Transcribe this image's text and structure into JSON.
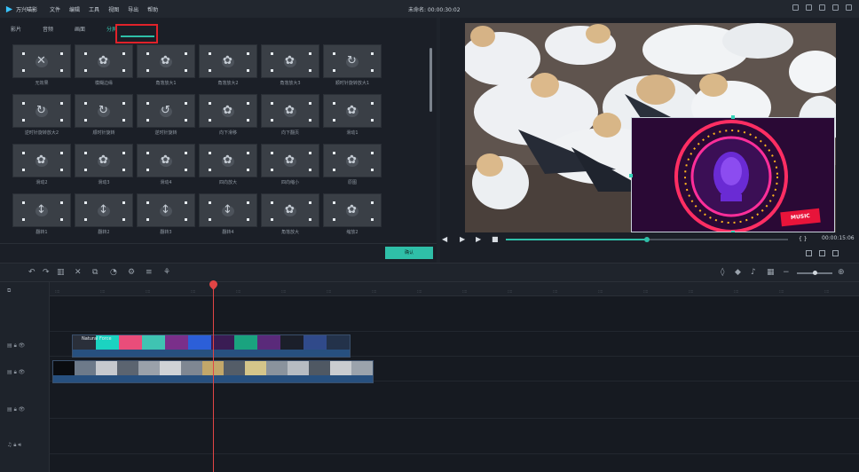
{
  "app": {
    "logo_text": "万兴喵影",
    "menu": [
      "文件",
      "编辑",
      "工具",
      "视图",
      "导出",
      "帮助"
    ],
    "project_title": "未命名: 00:00:30:02"
  },
  "library": {
    "tabs": [
      {
        "label": "影片"
      },
      {
        "label": "音频"
      },
      {
        "label": "画面"
      },
      {
        "label": "分屏"
      }
    ],
    "active_tab_index": 3,
    "ok_label": "确认",
    "items": [
      {
        "label": "无效果",
        "glyph": "✕"
      },
      {
        "label": "模糊边缘",
        "glyph": "✿"
      },
      {
        "label": "角落放大1",
        "glyph": "✿"
      },
      {
        "label": "角落放大2",
        "glyph": "✿"
      },
      {
        "label": "角落放大3",
        "glyph": "✿"
      },
      {
        "label": "顺时针旋转放大1",
        "glyph": "↻"
      },
      {
        "label": "逆时针旋转放大2",
        "glyph": "↻"
      },
      {
        "label": "顺时针旋转",
        "glyph": "↻"
      },
      {
        "label": "逆时针旋转",
        "glyph": "↺"
      },
      {
        "label": "向下滑移",
        "glyph": "✿"
      },
      {
        "label": "向下翻页",
        "glyph": "✿"
      },
      {
        "label": "滑动1",
        "glyph": "✿"
      },
      {
        "label": "滑动2",
        "glyph": "✿"
      },
      {
        "label": "滑动3",
        "glyph": "✿"
      },
      {
        "label": "滑动4",
        "glyph": "✿"
      },
      {
        "label": "四向放大",
        "glyph": "✿"
      },
      {
        "label": "四向缩小",
        "glyph": "✿"
      },
      {
        "label": "原图",
        "glyph": "✿"
      },
      {
        "label": "翻转1",
        "glyph": "↕"
      },
      {
        "label": "翻转2",
        "glyph": "↕"
      },
      {
        "label": "翻转3",
        "glyph": "↕"
      },
      {
        "label": "翻转4",
        "glyph": "↕"
      },
      {
        "label": "角落放大",
        "glyph": "✿"
      },
      {
        "label": "缩放2",
        "glyph": "✿"
      }
    ]
  },
  "preview": {
    "badge_text": "MUSIC",
    "timecode": "00:00:15:06",
    "playback_progress": 0.5
  },
  "timeline": {
    "clip_title": "Natural Force"
  }
}
